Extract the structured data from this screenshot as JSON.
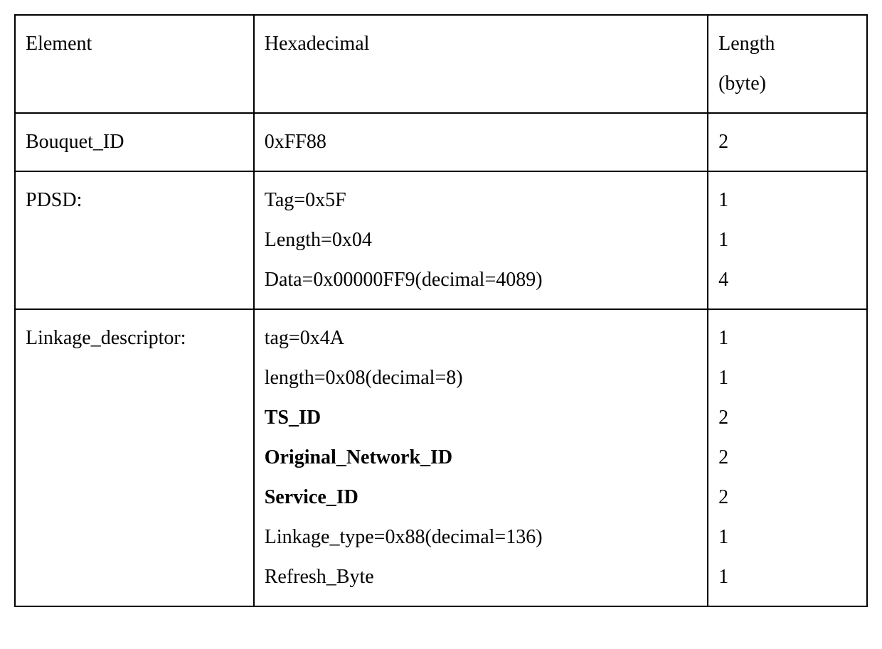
{
  "header": {
    "col1": "Element",
    "col2": "Hexadecimal",
    "col3_line1": "Length",
    "col3_line2": "(byte)"
  },
  "rows": [
    {
      "col1": "Bouquet_ID",
      "col2_lines": [
        {
          "text": "0xFF88",
          "bold": false
        }
      ],
      "col3_lines": [
        "2"
      ]
    },
    {
      "col1": "PDSD:",
      "col2_lines": [
        {
          "text": "Tag=0x5F",
          "bold": false
        },
        {
          "text": "Length=0x04",
          "bold": false
        },
        {
          "text": "Data=0x00000FF9(decimal=4089)",
          "bold": false
        }
      ],
      "col3_lines": [
        "1",
        "1",
        "4"
      ]
    },
    {
      "col1": "Linkage_descriptor:",
      "col2_lines": [
        {
          "text": "tag=0x4A",
          "bold": false
        },
        {
          "text": "length=0x08(decimal=8)",
          "bold": false
        },
        {
          "text": "TS_ID",
          "bold": true
        },
        {
          "text": "Original_Network_ID",
          "bold": true
        },
        {
          "text": "Service_ID",
          "bold": true
        },
        {
          "text": "Linkage_type=0x88(decimal=136)",
          "bold": false
        },
        {
          "text": "Refresh_Byte",
          "bold": false
        }
      ],
      "col3_lines": [
        "1",
        "1",
        "2",
        "2",
        "2",
        "1",
        "1"
      ]
    }
  ]
}
